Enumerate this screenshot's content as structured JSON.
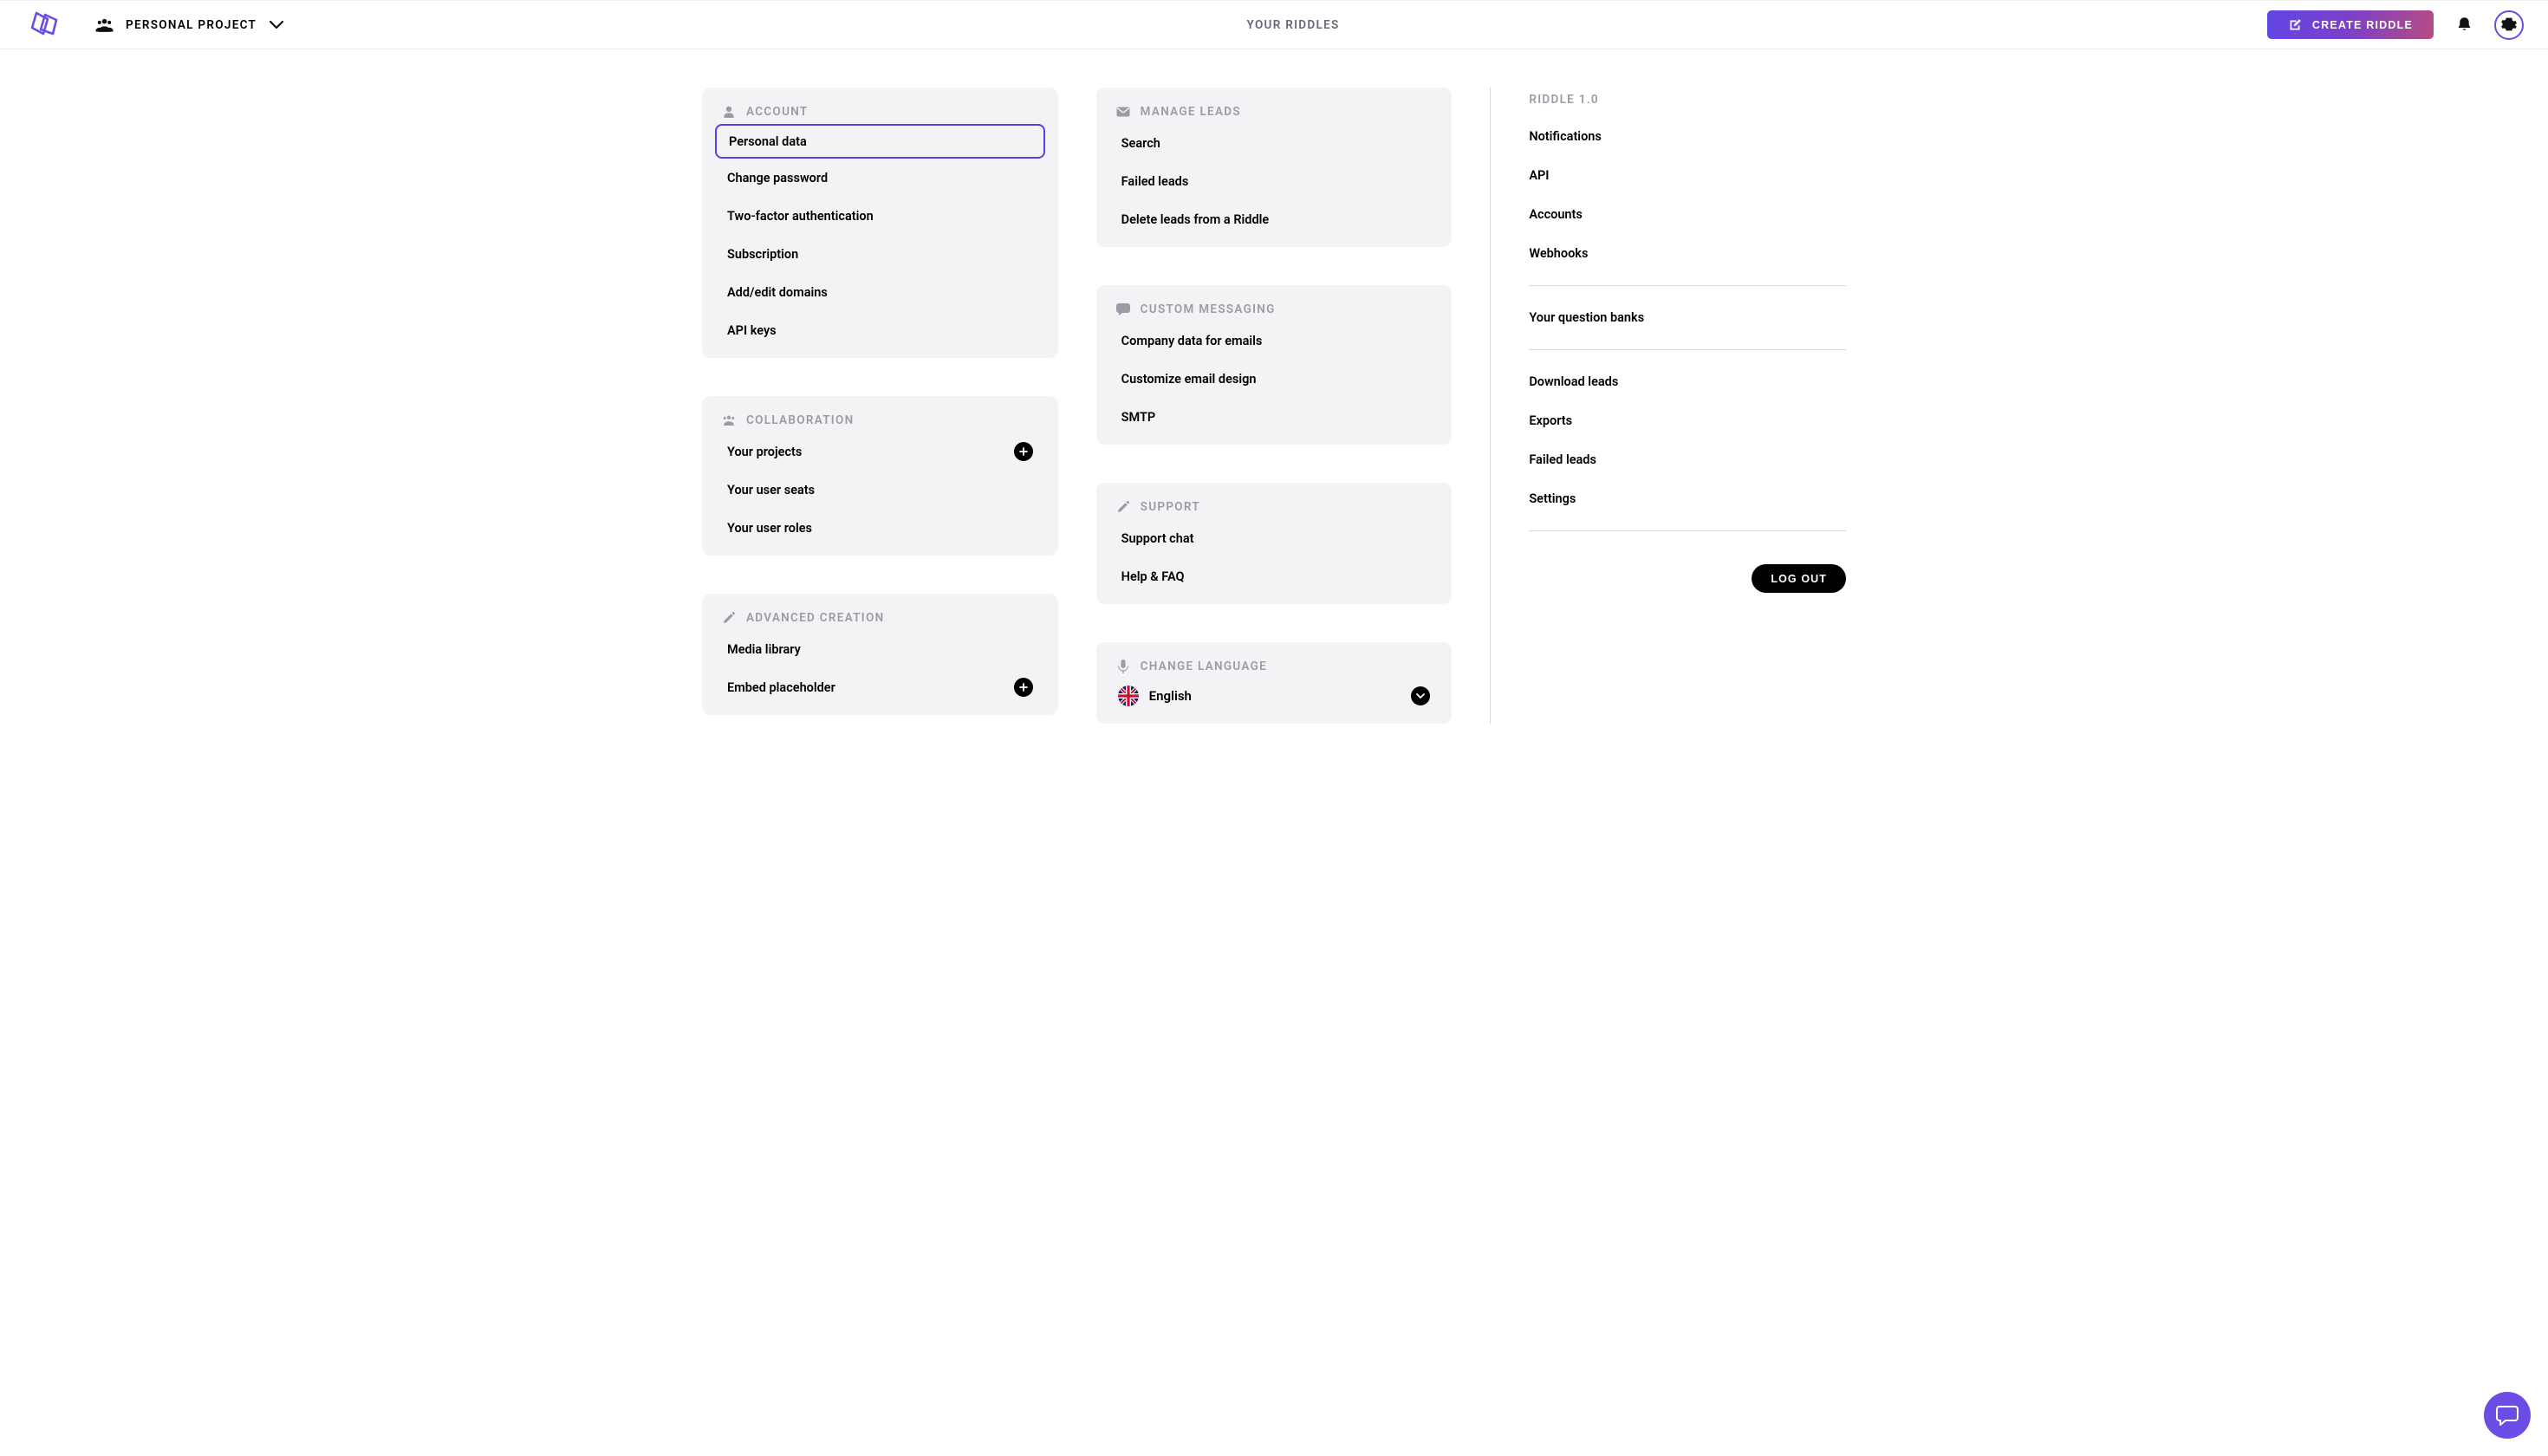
{
  "header": {
    "project_label": "PERSONAL PROJECT",
    "title": "YOUR RIDDLES",
    "create_label": "CREATE RIDDLE"
  },
  "sections": {
    "account": {
      "title": "ACCOUNT",
      "items": {
        "personal_data": "Personal data",
        "change_password": "Change password",
        "two_factor": "Two-factor authentication",
        "subscription": "Subscription",
        "domains": "Add/edit domains",
        "api_keys": "API keys"
      }
    },
    "collaboration": {
      "title": "COLLABORATION",
      "items": {
        "projects": "Your projects",
        "seats": "Your user seats",
        "roles": "Your user roles"
      }
    },
    "advanced": {
      "title": "ADVANCED CREATION",
      "items": {
        "media": "Media library",
        "embed": "Embed placeholder"
      }
    },
    "leads": {
      "title": "MANAGE LEADS",
      "items": {
        "search": "Search",
        "failed": "Failed leads",
        "delete": "Delete leads from a Riddle"
      }
    },
    "messaging": {
      "title": "CUSTOM MESSAGING",
      "items": {
        "company_data": "Company data for emails",
        "customize": "Customize email design",
        "smtp": "SMTP"
      }
    },
    "support": {
      "title": "SUPPORT",
      "items": {
        "chat": "Support chat",
        "help": "Help & FAQ"
      }
    },
    "language": {
      "title": "CHANGE LANGUAGE",
      "selected": "English"
    }
  },
  "side": {
    "title": "RIDDLE 1.0",
    "group1": {
      "notifications": "Notifications",
      "api": "API",
      "accounts": "Accounts",
      "webhooks": "Webhooks"
    },
    "group2": {
      "question_banks": "Your question banks"
    },
    "group3": {
      "download": "Download leads",
      "exports": "Exports",
      "failed": "Failed leads",
      "settings": "Settings"
    },
    "logout": "LOG OUT"
  }
}
